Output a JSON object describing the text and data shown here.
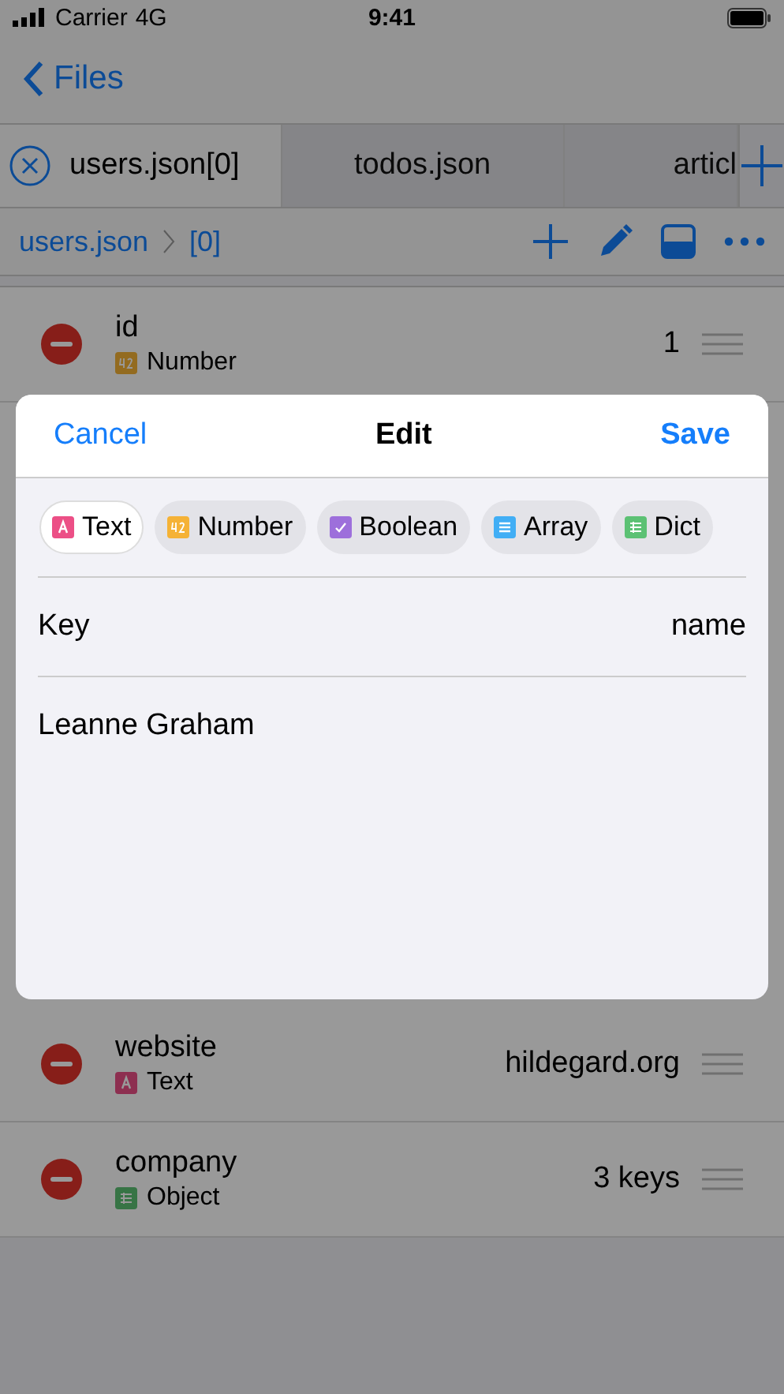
{
  "status_bar": {
    "carrier": "Carrier",
    "network": "4G",
    "time": "9:41"
  },
  "nav": {
    "back_label": "Files"
  },
  "tabs": [
    {
      "label": "users.json[0]",
      "selected": true,
      "closable": true
    },
    {
      "label": "todos.json",
      "selected": false,
      "closable": false
    },
    {
      "label": "articl",
      "selected": false,
      "closable": false
    }
  ],
  "breadcrumb": [
    "users.json",
    "[0]"
  ],
  "rows": [
    {
      "key": "id",
      "type": "Number",
      "kind": "number",
      "value": "1"
    },
    {
      "key": "website",
      "type": "Text",
      "kind": "text",
      "value": "hildegard.org"
    },
    {
      "key": "company",
      "type": "Object",
      "kind": "dict",
      "value": "3 keys"
    }
  ],
  "dialog": {
    "cancel": "Cancel",
    "title": "Edit",
    "save": "Save",
    "types": [
      {
        "label": "Text",
        "kind": "text",
        "selected": true
      },
      {
        "label": "Number",
        "kind": "number",
        "selected": false
      },
      {
        "label": "Boolean",
        "kind": "boolean",
        "selected": false
      },
      {
        "label": "Array",
        "kind": "array",
        "selected": false
      },
      {
        "label": "Dict",
        "kind": "dict",
        "selected": false
      }
    ],
    "key_label": "Key",
    "key_value": "name",
    "value": "Leanne Graham"
  }
}
